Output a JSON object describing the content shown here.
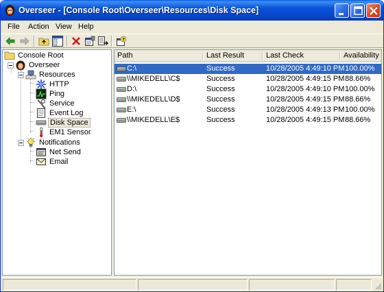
{
  "window": {
    "title": "Overseer - [Console Root\\Overseer\\Resources\\Disk Space]"
  },
  "menu": {
    "items": [
      "File",
      "Action",
      "View",
      "Help"
    ]
  },
  "toolbar": {
    "icons": [
      "back-icon",
      "forward-icon",
      "up-folder-icon",
      "show-hide-tree-icon",
      "delete-icon",
      "properties-icon",
      "export-list-icon",
      "help-icon"
    ]
  },
  "tree": {
    "root": "Console Root",
    "overseer": "Overseer",
    "resources": "Resources",
    "http": "HTTP",
    "ping": "Ping",
    "service": "Service",
    "eventlog": "Event Log",
    "diskspace": "Disk Space",
    "em1": "EM1 Sensor",
    "notifications": "Notifications",
    "netsend": "Net Send",
    "email": "Email"
  },
  "list": {
    "columns": [
      "Path",
      "Last Result",
      "Last Check",
      "Availability"
    ],
    "rows": [
      {
        "path": "C:\\",
        "result": "Success",
        "check": "10/28/2005 4:49:10 PM",
        "availability": "100.00%"
      },
      {
        "path": "\\\\MIKEDELL\\C$",
        "result": "Success",
        "check": "10/28/2005 4:49:15 PM",
        "availability": "88.66%"
      },
      {
        "path": "D:\\",
        "result": "Success",
        "check": "10/28/2005 4:49:10 PM",
        "availability": "100.00%"
      },
      {
        "path": "\\\\MIKEDELL\\D$",
        "result": "Success",
        "check": "10/28/2005 4:49:15 PM",
        "availability": "88.66%"
      },
      {
        "path": "E:\\",
        "result": "Success",
        "check": "10/28/2005 4:49:13 PM",
        "availability": "100.00%"
      },
      {
        "path": "\\\\MIKEDELL\\E$",
        "result": "Success",
        "check": "10/28/2005 4:49:15 PM",
        "availability": "88.66%"
      }
    ]
  },
  "colors": {
    "titlebar": "#0a52d8",
    "selection": "#316ac5",
    "chrome": "#ece9d8"
  }
}
